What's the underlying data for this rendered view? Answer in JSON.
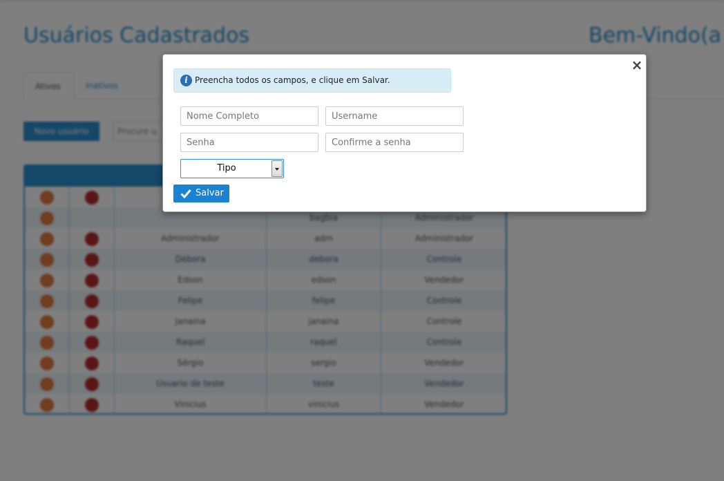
{
  "background": {
    "page_title": "Usuários Cadastrados",
    "welcome": "Bem-Vindo(a",
    "tabs": [
      "Ativos",
      "Inativos"
    ],
    "new_user_button": "Novo usuário",
    "search_placeholder": "Procure u",
    "users": [
      {
        "name": "",
        "username": "",
        "type": ""
      },
      {
        "name": "",
        "username": "bagbia",
        "type": "Administrador"
      },
      {
        "name": "Administrador",
        "username": "adm",
        "type": "Administrador"
      },
      {
        "name": "Débora",
        "username": "debora",
        "type": "Controle"
      },
      {
        "name": "Edson",
        "username": "edson",
        "type": "Vendedor"
      },
      {
        "name": "Felipe",
        "username": "felipe",
        "type": "Controle"
      },
      {
        "name": "Janaina",
        "username": "janaina",
        "type": "Controle"
      },
      {
        "name": "Raquel",
        "username": "raquel",
        "type": "Controle"
      },
      {
        "name": "Sérgio",
        "username": "sergio",
        "type": "Vendedor"
      },
      {
        "name": "Usuario de teste",
        "username": "teste",
        "type": "Vendedor"
      },
      {
        "name": "Vinicius",
        "username": "vinicius",
        "type": "Vendedor"
      }
    ]
  },
  "modal": {
    "close_symbol": "×",
    "alert_icon": "info-icon",
    "alert_text": "Preencha todos os campos, e clique em Salvar.",
    "fields": {
      "name_placeholder": "Nome Completo",
      "username_placeholder": "Username",
      "password_placeholder": "Senha",
      "confirm_placeholder": "Confirme a senha"
    },
    "type_select": {
      "selected": "Tipo"
    },
    "save_button": "Salvar"
  },
  "colors": {
    "accent": "#1a82d0",
    "alert_bg": "#d9edf7",
    "edit": "#e07a3f",
    "delete": "#b52b2b"
  }
}
